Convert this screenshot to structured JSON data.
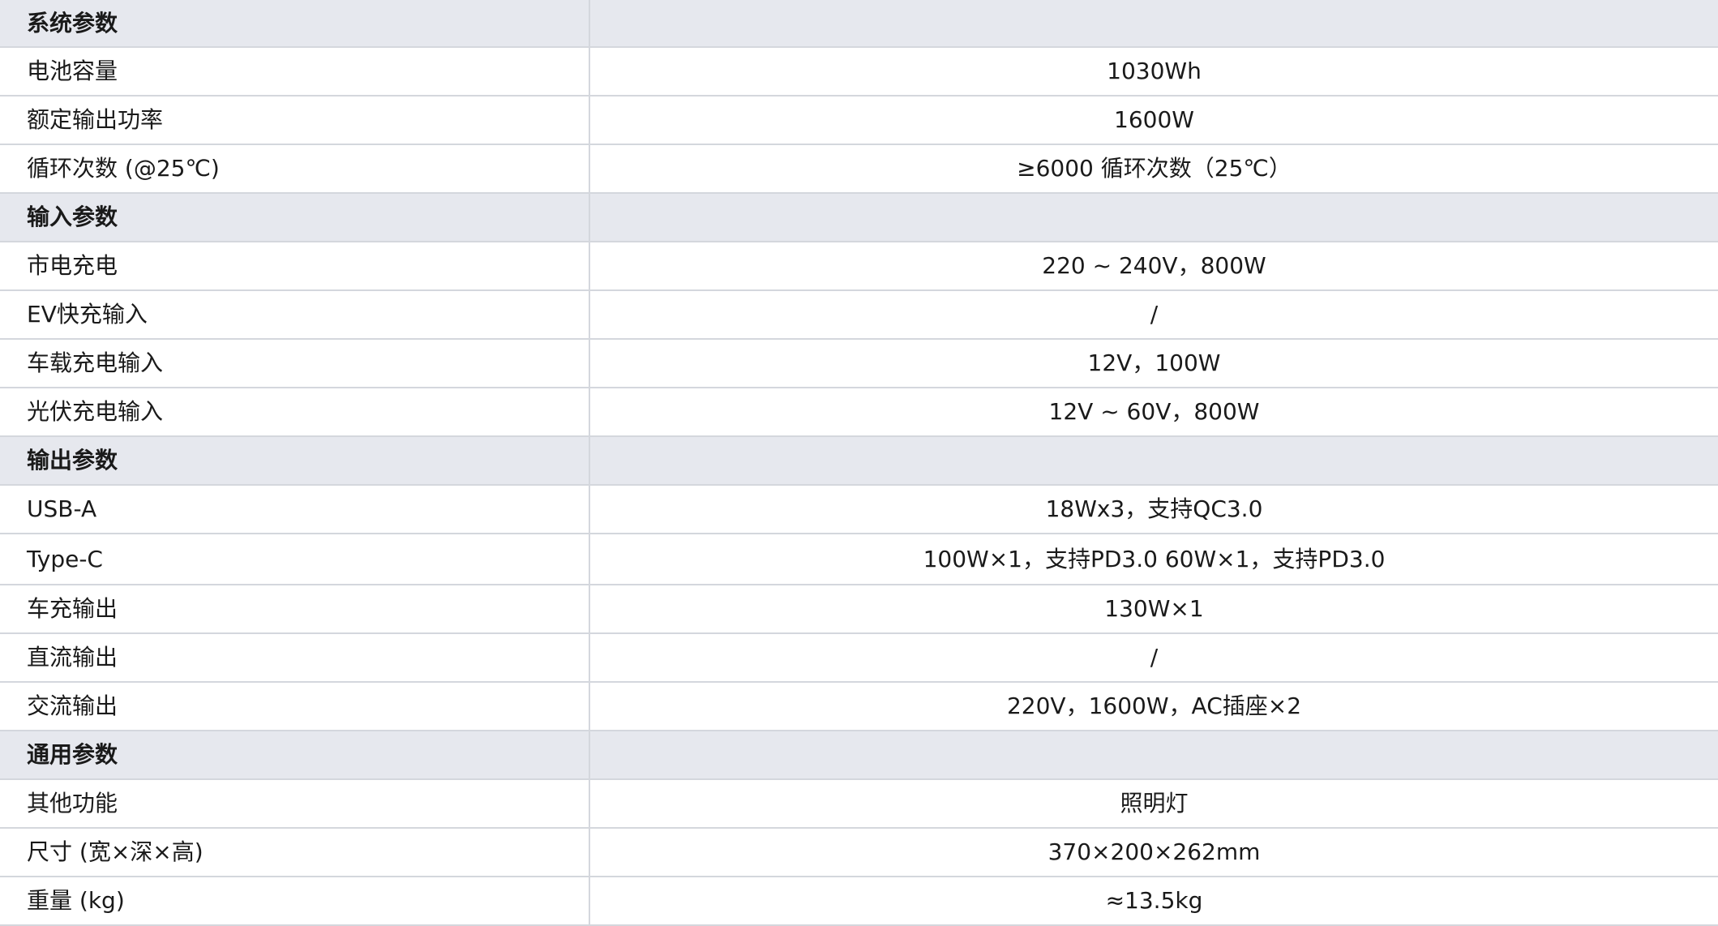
{
  "rows": [
    {
      "type": "section",
      "label": "系统参数",
      "value": ""
    },
    {
      "type": "item",
      "label": "电池容量",
      "value": "1030Wh"
    },
    {
      "type": "item",
      "label": "额定输出功率",
      "value": "1600W"
    },
    {
      "type": "item",
      "label": "循环次数 (@25℃)",
      "value": "≥6000 循环次数（25℃）"
    },
    {
      "type": "section",
      "label": "输入参数",
      "value": ""
    },
    {
      "type": "item",
      "label": "市电充电",
      "value": "220 ~ 240V，800W"
    },
    {
      "type": "item",
      "label": "EV快充输入",
      "value": "/"
    },
    {
      "type": "item",
      "label": "车载充电输入",
      "value": "12V，100W"
    },
    {
      "type": "item",
      "label": "光伏充电输入",
      "value": "12V ~ 60V，800W"
    },
    {
      "type": "section",
      "label": "输出参数",
      "value": ""
    },
    {
      "type": "item",
      "label": "USB-A",
      "value": "18Wx3，支持QC3.0"
    },
    {
      "type": "item",
      "label": "Type-C",
      "value": "100W×1，支持PD3.0   60W×1，支持PD3.0"
    },
    {
      "type": "item",
      "label": "车充输出",
      "value": "130W×1"
    },
    {
      "type": "item",
      "label": "直流输出",
      "value": "/"
    },
    {
      "type": "item",
      "label": "交流输出",
      "value": "220V，1600W，AC插座×2"
    },
    {
      "type": "section",
      "label": "通用参数",
      "value": ""
    },
    {
      "type": "item",
      "label": "其他功能",
      "value": "照明灯"
    },
    {
      "type": "item",
      "label": "尺寸 (宽×深×高)",
      "value": "370×200×262mm"
    },
    {
      "type": "item",
      "label": "重量 (kg)",
      "value": "≈13.5kg"
    }
  ],
  "colors": {
    "section_background": "#e6e8ee",
    "border": "#d4d7dd",
    "text": "#1a1a1a"
  }
}
